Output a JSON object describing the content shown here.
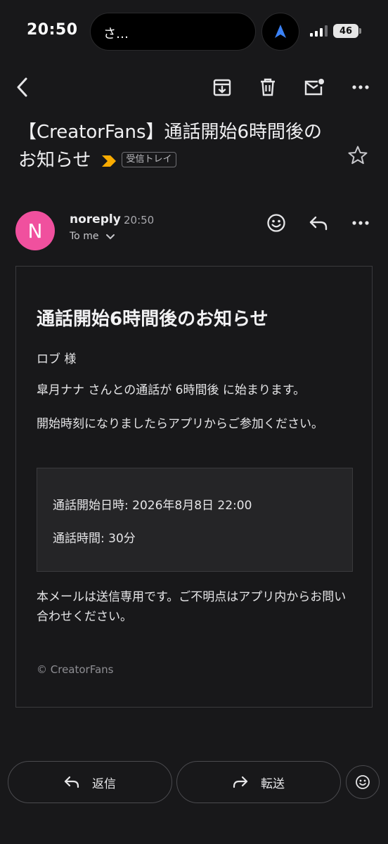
{
  "status_bar": {
    "time": "20:50",
    "island_text": "さ…",
    "battery": "46",
    "nav_icon": "navigation-arrow-icon"
  },
  "toolbar": {
    "back_icon": "back-chevron-icon",
    "archive_icon": "archive-icon",
    "delete_icon": "trash-icon",
    "unread_icon": "mark-unread-icon",
    "more_icon": "more-horizontal-icon"
  },
  "email": {
    "subject": "【CreatorFans】通話開始6時間後のお知らせ",
    "label": "受信トレイ",
    "important_color": "#f9ab00",
    "sender": {
      "initial": "N",
      "name": "noreply",
      "time": "20:50",
      "recipient": "To me",
      "avatar_color": "#f0509e"
    },
    "body": {
      "title": "通話開始6時間後のお知らせ",
      "greeting": "ロブ 様",
      "line1": "皐月ナナ さんとの通話が 6時間後 に始まります。",
      "line2": "開始時刻になりましたらアプリからご参加ください。",
      "info_start": "通話開始日時: 2026年8月8日 22:00",
      "info_duration": "通話時間: 30分",
      "note": "本メールは送信専用です。ご不明点はアプリ内からお問い合わせください。",
      "footer": "© CreatorFans"
    }
  },
  "actions": {
    "reply": "返信",
    "forward": "転送"
  }
}
